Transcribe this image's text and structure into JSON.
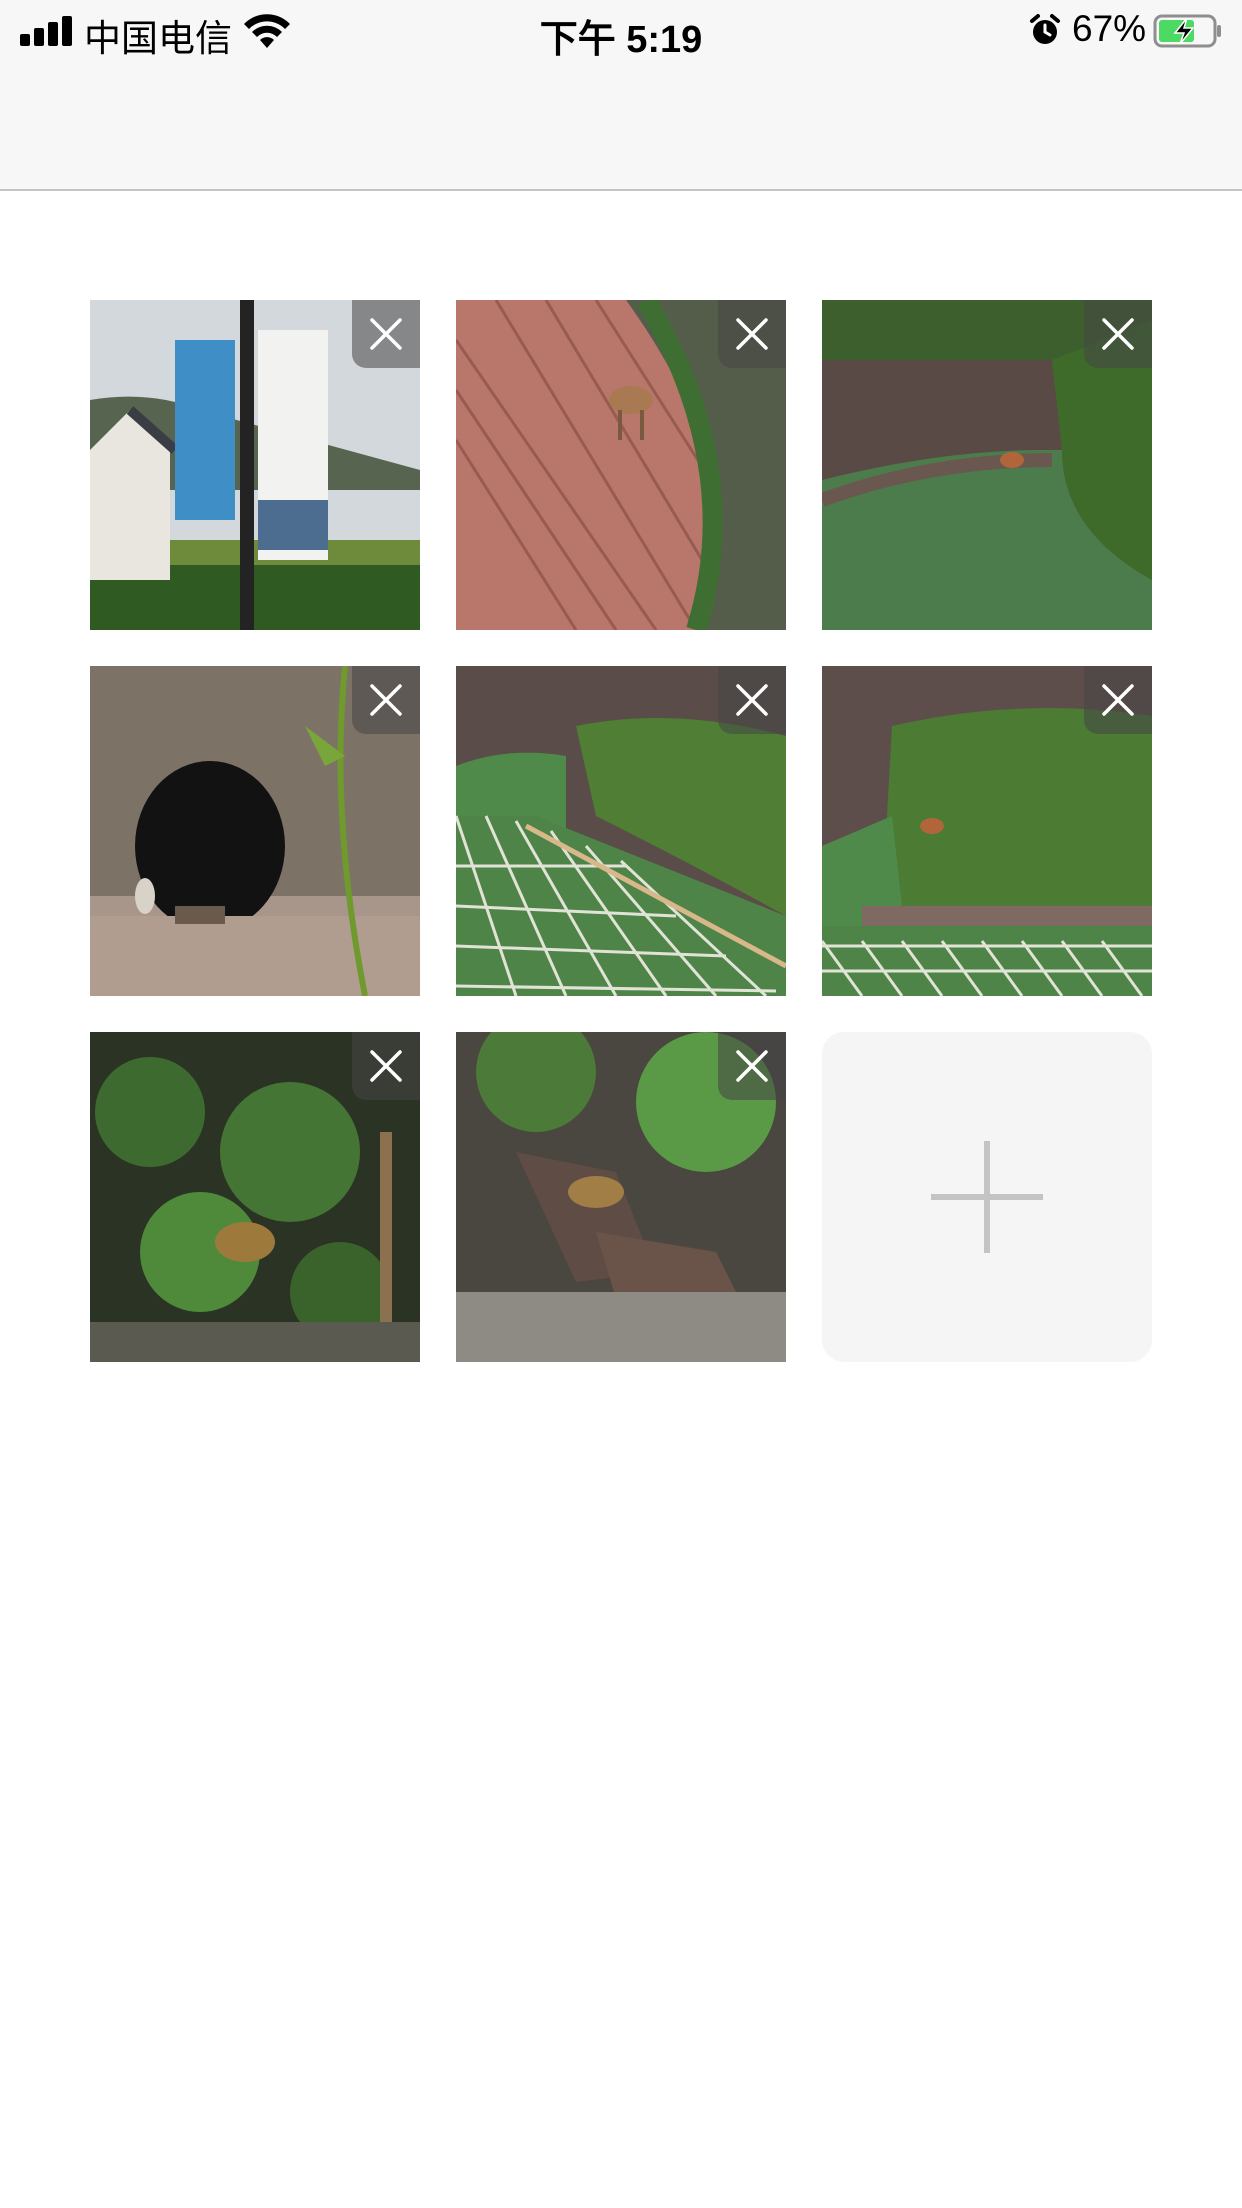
{
  "status_bar": {
    "carrier": "中国电信",
    "time": "下午 5:19",
    "battery_percent": "67%",
    "battery_level": 0.67,
    "icons": [
      "signal-icon",
      "wifi-icon",
      "alarm-icon",
      "battery-charging-icon"
    ]
  },
  "photo_grid": {
    "photos": [
      {
        "name": "photo-banner-lamppost",
        "scene": "banners",
        "delete_icon": "close-icon"
      },
      {
        "name": "photo-deer-brick-path",
        "scene": "deer-path",
        "delete_icon": "close-icon"
      },
      {
        "name": "photo-green-moat",
        "scene": "moat",
        "delete_icon": "close-icon"
      },
      {
        "name": "photo-wolf-cave",
        "scene": "cave",
        "delete_icon": "close-icon"
      },
      {
        "name": "photo-enclosure-net-1",
        "scene": "net",
        "delete_icon": "close-icon"
      },
      {
        "name": "photo-enclosure-net-2",
        "scene": "net2",
        "delete_icon": "close-icon"
      },
      {
        "name": "photo-leopard-foliage",
        "scene": "foliage",
        "delete_icon": "close-icon"
      },
      {
        "name": "photo-leopard-rocks",
        "scene": "rocks",
        "delete_icon": "close-icon"
      }
    ],
    "add_button": {
      "icon": "plus-icon"
    }
  },
  "colors": {
    "header_bg": "#f7f7f7",
    "battery_green": "#4cd964",
    "add_tile_bg": "#f5f5f5",
    "plus_color": "#c4c4c4"
  }
}
